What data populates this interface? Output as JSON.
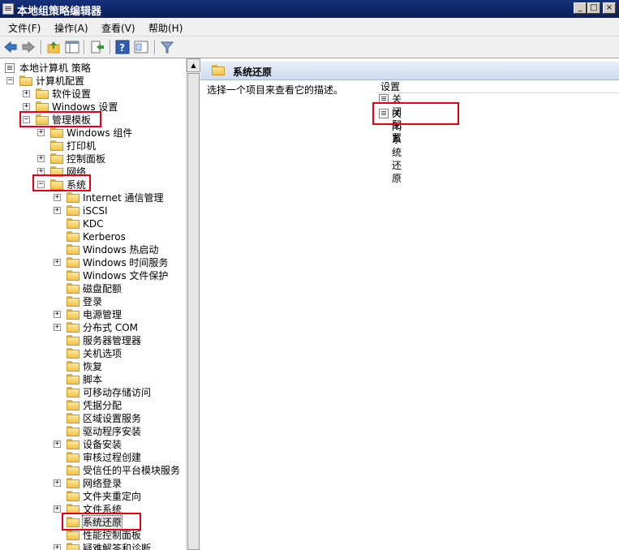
{
  "window": {
    "title": "本地组策略编辑器",
    "min": "_",
    "max": "□",
    "close": "×"
  },
  "menu": {
    "file": "文件(F)",
    "action": "操作(A)",
    "view": "查看(V)",
    "help": "帮助(H)"
  },
  "toolbar": {
    "icons": [
      "back-icon",
      "forward-icon",
      "up-folder-icon",
      "show-tree-icon",
      "export-icon",
      "help-icon",
      "properties-icon",
      "filter-icon"
    ]
  },
  "tree": {
    "root": "本地计算机 策略",
    "computer_config": "计算机配置",
    "software_settings": "软件设置",
    "windows_settings": "Windows 设置",
    "admin_templates": "管理模板",
    "windows_components": "Windows 组件",
    "printers": "打印机",
    "control_panel": "控制面板",
    "network": "网络",
    "system": "系统",
    "system_children": [
      "Internet 通信管理",
      "iSCSI",
      "KDC",
      "Kerberos",
      "Windows 热启动",
      "Windows 时间服务",
      "Windows 文件保护",
      "磁盘配额",
      "登录",
      "电源管理",
      "分布式 COM",
      "服务器管理器",
      "关机选项",
      "恢复",
      "脚本",
      "可移动存储访问",
      "凭据分配",
      "区域设置服务",
      "驱动程序安装",
      "设备安装",
      "审核过程创建",
      "受信任的平台模块服务",
      "网络登录",
      "文件夹重定向",
      "文件系统",
      "系统还原",
      "性能控制面板",
      "疑难解答和诊断"
    ]
  },
  "right": {
    "header_title": "系统还原",
    "description": "选择一个项目来查看它的描述。",
    "column_header": "设置",
    "items": [
      "关闭配置",
      "关闭系统还原"
    ]
  },
  "colors": {
    "annotation_red": "#e60012",
    "title_bar": "#0a246a"
  }
}
